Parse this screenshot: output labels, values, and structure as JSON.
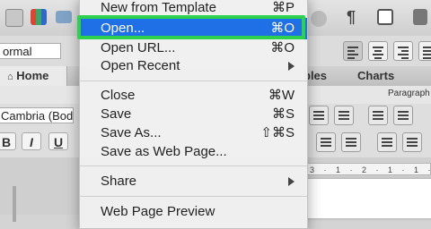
{
  "toolbar": {
    "paragraph_mark": "¶"
  },
  "ribbon": {
    "style_value": "ormal"
  },
  "tabs": [
    {
      "label": "Home"
    },
    {
      "label": "bles"
    },
    {
      "label": "Charts"
    }
  ],
  "groupbar": {
    "paragraph_label": "Paragraph"
  },
  "format": {
    "font_value": "Cambria (Body)",
    "bold": "B",
    "italic": "I",
    "underline": "U"
  },
  "ruler": {
    "text": "3 · 1 · 2 · 1 · 1 · 1"
  },
  "file_menu": {
    "items": [
      {
        "label": "New from Template",
        "shortcut": "⌘P"
      },
      {
        "label": "Open...",
        "shortcut": "⌘O",
        "highlighted": true
      },
      {
        "label": "Open URL...",
        "shortcut": "⌘O"
      },
      {
        "label": "Open Recent",
        "submenu": true
      },
      {
        "label": "Close",
        "shortcut": "⌘W"
      },
      {
        "label": "Save",
        "shortcut": "⌘S"
      },
      {
        "label": "Save As...",
        "shortcut": "⇧⌘S"
      },
      {
        "label": "Save as Web Page..."
      },
      {
        "label": "Share",
        "submenu": true
      },
      {
        "label": "Web Page Preview"
      }
    ]
  },
  "colors": {
    "highlight": "#1f6fe6",
    "callout": "#2dd14b"
  }
}
